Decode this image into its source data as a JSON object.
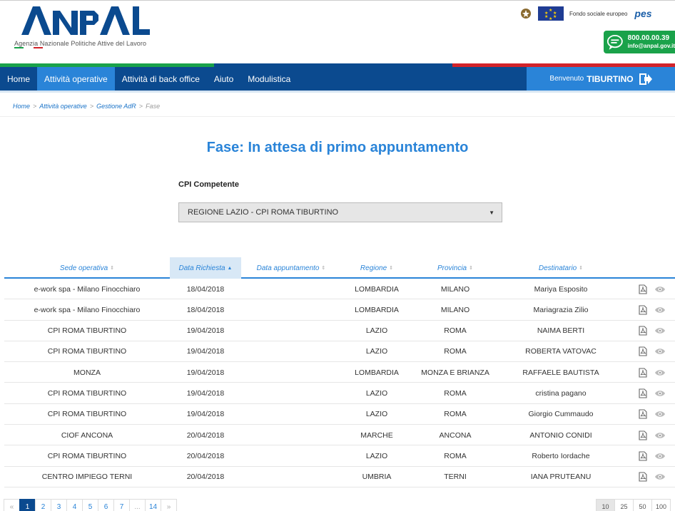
{
  "header": {
    "logo_text": "ANPAL",
    "agency_name": "Agenzia Nazionale Politiche Attive del Lavoro",
    "fse_text": "Fondo sociale europeo",
    "pes_text": "pes",
    "phone": "800.00.00.39",
    "email": "info@anpal.gov.it"
  },
  "nav": {
    "items": [
      {
        "label": "Home"
      },
      {
        "label": "Attività operative",
        "active": true
      },
      {
        "label": "Attività di back office"
      },
      {
        "label": "Aiuto"
      },
      {
        "label": "Modulistica"
      }
    ],
    "welcome_label": "Benvenuto",
    "user_name": "TIBURTINO"
  },
  "breadcrumb": {
    "items": [
      "Home",
      "Attività operative",
      "Gestione AdR"
    ],
    "current": "Fase",
    "separator": ">"
  },
  "page": {
    "title": "Fase: In attesa di primo appuntamento",
    "cpi_label": "CPI Competente",
    "cpi_value": "REGIONE LAZIO - CPI ROMA TIBURTINO"
  },
  "table": {
    "sort_idle": "⇕",
    "sort_asc": "▲",
    "columns": [
      {
        "label": "Sede operativa"
      },
      {
        "label": "Data Richiesta",
        "sorted": true
      },
      {
        "label": "Data appuntamento"
      },
      {
        "label": "Regione"
      },
      {
        "label": "Provincia"
      },
      {
        "label": "Destinatario"
      }
    ],
    "rows": [
      {
        "sede": "e-work spa - Milano Finocchiaro",
        "data": "18/04/2018",
        "appuntamento": "",
        "regione": "LOMBARDIA",
        "provincia": "MILANO",
        "destinatario": "Mariya Esposito"
      },
      {
        "sede": "e-work spa - Milano Finocchiaro",
        "data": "18/04/2018",
        "appuntamento": "",
        "regione": "LOMBARDIA",
        "provincia": "MILANO",
        "destinatario": "Mariagrazia Zilio"
      },
      {
        "sede": "CPI ROMA TIBURTINO",
        "data": "19/04/2018",
        "appuntamento": "",
        "regione": "LAZIO",
        "provincia": "ROMA",
        "destinatario": "NAIMA BERTI"
      },
      {
        "sede": "CPI ROMA TIBURTINO",
        "data": "19/04/2018",
        "appuntamento": "",
        "regione": "LAZIO",
        "provincia": "ROMA",
        "destinatario": "ROBERTA VATOVAC"
      },
      {
        "sede": "MONZA",
        "data": "19/04/2018",
        "appuntamento": "",
        "regione": "LOMBARDIA",
        "provincia": "MONZA E BRIANZA",
        "destinatario": "RAFFAELE BAUTISTA"
      },
      {
        "sede": "CPI ROMA TIBURTINO",
        "data": "19/04/2018",
        "appuntamento": "",
        "regione": "LAZIO",
        "provincia": "ROMA",
        "destinatario": "cristina pagano"
      },
      {
        "sede": "CPI ROMA TIBURTINO",
        "data": "19/04/2018",
        "appuntamento": "",
        "regione": "LAZIO",
        "provincia": "ROMA",
        "destinatario": "Giorgio Cummaudo"
      },
      {
        "sede": "CIOF ANCONA",
        "data": "20/04/2018",
        "appuntamento": "",
        "regione": "MARCHE",
        "provincia": "ANCONA",
        "destinatario": "ANTONIO CONIDI"
      },
      {
        "sede": "CPI ROMA TIBURTINO",
        "data": "20/04/2018",
        "appuntamento": "",
        "regione": "LAZIO",
        "provincia": "ROMA",
        "destinatario": "Roberto Iordache"
      },
      {
        "sede": "CENTRO IMPIEGO TERNI",
        "data": "20/04/2018",
        "appuntamento": "",
        "regione": "UMBRIA",
        "provincia": "TERNI",
        "destinatario": "IANA PRUTEANU"
      }
    ]
  },
  "pagination": {
    "prev": "«",
    "pages": [
      "1",
      "2",
      "3",
      "4",
      "5",
      "6",
      "7",
      "...",
      "14"
    ],
    "next": "»",
    "current": "1",
    "page_sizes": [
      "10",
      "25",
      "50",
      "100"
    ],
    "current_page_size": "10"
  },
  "colors": {
    "nav_dark": "#0b4a8f",
    "nav_light": "#2a84d8",
    "accent_green": "#1aa24a",
    "bar_red": "#d2232a"
  }
}
